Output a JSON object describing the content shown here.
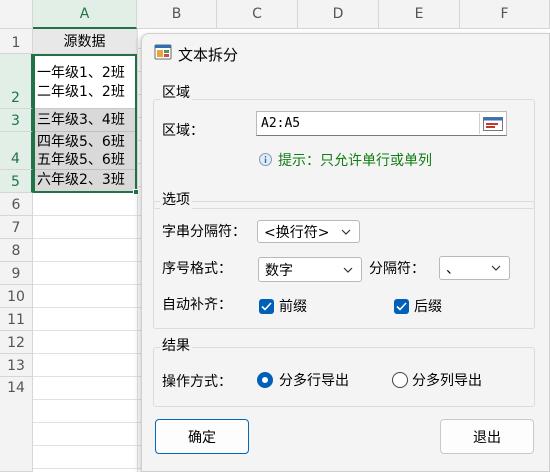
{
  "sheet": {
    "columns": [
      "A",
      "B",
      "C",
      "D",
      "E",
      "F"
    ],
    "rows": [
      "1",
      "2",
      "3",
      "4",
      "5",
      "6",
      "7",
      "8",
      "9",
      "10",
      "11",
      "12",
      "13",
      "14"
    ],
    "header_cell": "源数据",
    "cells": [
      {
        "lines": [
          "一年级1、2班",
          "二年级1、2班"
        ]
      },
      {
        "lines": [
          "三年级3、4班"
        ]
      },
      {
        "lines": [
          "四年级5、6班",
          "五年级5、6班"
        ]
      },
      {
        "lines": [
          "六年级2、3班"
        ]
      }
    ]
  },
  "dialog": {
    "title": "文本拆分",
    "region_group": "区域",
    "region_label": "区域：",
    "region_value": "A2:A5",
    "tip": "提示：只允许单行或单列",
    "options_group": "选项",
    "separator_label": "字串分隔符：",
    "separator_value": "<换行符>",
    "number_format_label": "序号格式：",
    "number_format_value": "数字",
    "delimiter_label": "分隔符：",
    "delimiter_value": "、",
    "auto_fill_label": "自动补齐：",
    "prefix_label": "前缀",
    "suffix_label": "后缀",
    "prefix_checked": true,
    "suffix_checked": true,
    "result_group": "结果",
    "operation_label": "操作方式：",
    "option_rows": "分多行导出",
    "option_cols": "分多列导出",
    "selected_option": "rows",
    "ok_button": "确定",
    "exit_button": "退出"
  },
  "colors": {
    "accent": "#005fb8",
    "excel_green": "#217346",
    "tip_green": "#107c10"
  }
}
